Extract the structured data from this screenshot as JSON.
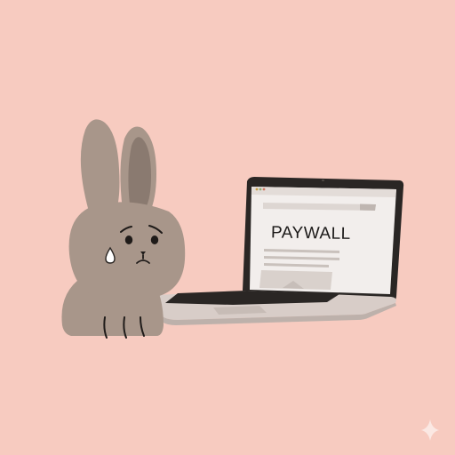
{
  "screen": {
    "heading": "PAYWALL"
  },
  "icons": {
    "character": "sad-rabbit-illustration",
    "device": "laptop-icon",
    "corner_mark": "sparkle-icon",
    "tear": "teardrop-icon"
  },
  "colors": {
    "background": "#f7cbc0",
    "rabbit_body": "#a8968a",
    "rabbit_inner_ear": "#8a7a70",
    "laptop_frame": "#2a2624",
    "laptop_base": "#d8cdc8",
    "screen_bg": "#f2eeec"
  }
}
